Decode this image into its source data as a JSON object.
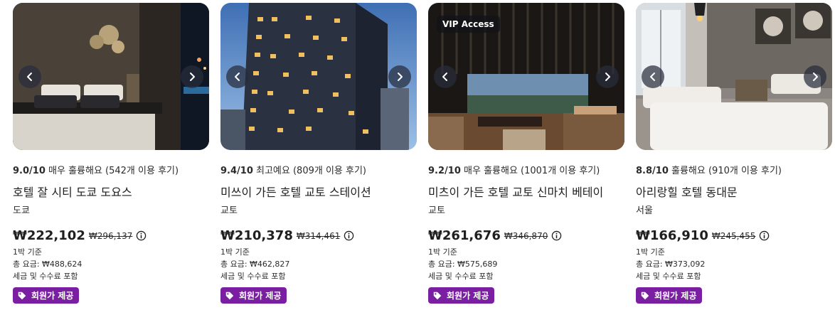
{
  "cards": [
    {
      "vip": "",
      "rating_score": "9.0/10",
      "rating_text": "매우 훌륭해요 (542개 이용 후기)",
      "name": "호텔 잘 시티 도쿄 도요스",
      "city": "도쿄",
      "price": "₩222,102",
      "old_price": "₩296,137",
      "per_night": "1박 기준",
      "total": "총 요금: ₩488,624",
      "tax": "세금 및 수수료 포함",
      "badge": "회원가 제공"
    },
    {
      "vip": "",
      "rating_score": "9.4/10",
      "rating_text": "최고예요 (809개 이용 후기)",
      "name": "미쓰이 가든 호텔 교토 스테이션",
      "city": "교토",
      "price": "₩210,378",
      "old_price": "₩314,461",
      "per_night": "1박 기준",
      "total": "총 요금: ₩462,827",
      "tax": "세금 및 수수료 포함",
      "badge": "회원가 제공"
    },
    {
      "vip": "VIP Access",
      "rating_score": "9.2/10",
      "rating_text": "매우 훌륭해요 (1001개 이용 후기)",
      "name": "미츠이 가든 호텔 교토 신마치 베테이",
      "city": "교토",
      "price": "₩261,676",
      "old_price": "₩346,870",
      "per_night": "1박 기준",
      "total": "총 요금: ₩575,689",
      "tax": "세금 및 수수료 포함",
      "badge": "회원가 제공"
    },
    {
      "vip": "",
      "rating_score": "8.8/10",
      "rating_text": "훌륭해요 (910개 이용 후기)",
      "name": "아리랑힐 호텔 동대문",
      "city": "서울",
      "price": "₩166,910",
      "old_price": "₩245,455",
      "per_night": "1박 기준",
      "total": "총 요금: ₩373,092",
      "tax": "세금 및 수수료 포함",
      "badge": "회원가 제공"
    }
  ],
  "icons": {
    "prev": "chevron-left-icon",
    "next": "chevron-right-icon",
    "info": "info-icon",
    "tag": "tag-icon"
  },
  "colors": {
    "badge": "#7b1fa2",
    "nav_button": "#2c2f3c"
  }
}
